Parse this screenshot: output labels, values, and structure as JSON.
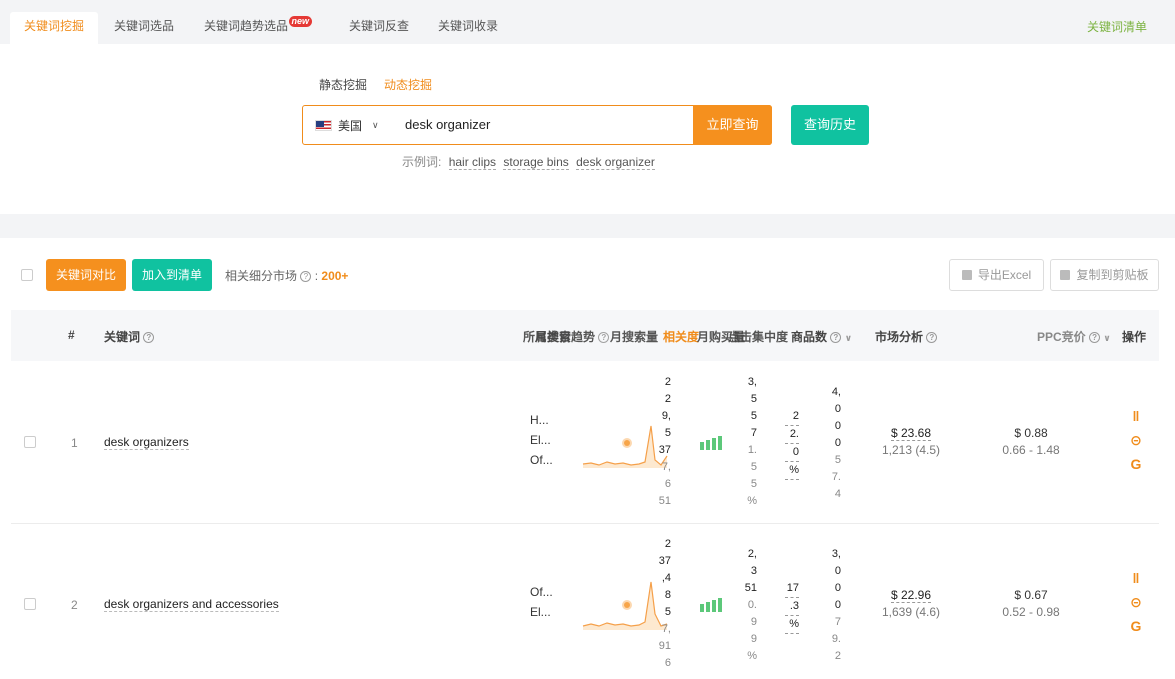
{
  "tabs": [
    {
      "label": "关键词挖掘",
      "active": true
    },
    {
      "label": "关键词选品",
      "active": false
    },
    {
      "label": "关键词趋势选品",
      "active": false,
      "badge": "new"
    },
    {
      "label": "关键词反查",
      "active": false
    },
    {
      "label": "关键词收录",
      "active": false
    }
  ],
  "top_right_link": "关键词清单",
  "search": {
    "modes": [
      {
        "label": "静态挖掘",
        "active": false
      },
      {
        "label": "动态挖掘",
        "active": true
      }
    ],
    "country": "美国",
    "query": "desk organizer",
    "submit_label": "立即查询",
    "history_label": "查询历史",
    "examples_label": "示例词:",
    "examples": [
      "hair clips",
      "storage bins",
      "desk organizer"
    ]
  },
  "toolbar": {
    "compare_label": "关键词对比",
    "add_label": "加入到清单",
    "market_label": "相关细分市场",
    "market_count": "200+",
    "export_label": "导出Excel",
    "copy_label": "复制到剪贴板"
  },
  "table": {
    "headers": {
      "index": "#",
      "keyword": "关键词",
      "categories": "所属类目",
      "trend_overlap": "月搜索趋势",
      "search_volume": "月搜索量",
      "relevance": "相关度",
      "purchase": "月购买量",
      "click_concentration": "点击集中度",
      "products": "商品数",
      "market": "市场分析",
      "ppc": "PPC竞价",
      "actions": "操作"
    },
    "rows": [
      {
        "index": "1",
        "keyword": "desk organizers",
        "categories": [
          "H...",
          "El...",
          "Of..."
        ],
        "volume_stack": [
          "2",
          "2",
          "9,",
          "5",
          "37",
          "7,",
          "6",
          "51"
        ],
        "purchase_stack": [
          "3,",
          "5",
          "5",
          "7",
          "1.",
          "5",
          "5",
          "%"
        ],
        "concentration_stack": [
          "2",
          "2.",
          "0",
          "%"
        ],
        "products_stack": [
          "4,",
          "0",
          "0",
          "0",
          "5",
          "7.",
          "4"
        ],
        "market_price": "$ 23.68",
        "market_sub": "1,213 (4.5)",
        "ppc_price": "$ 0.88",
        "ppc_range": "0.66 - 1.48",
        "spark_peak": 0.95,
        "bars": [
          3,
          4,
          5,
          6
        ]
      },
      {
        "index": "2",
        "keyword": "desk organizers and accessories",
        "categories": [
          "Of...",
          "El..."
        ],
        "volume_stack": [
          "2",
          "37",
          ",4",
          "8",
          "5",
          "7,",
          "91",
          "6"
        ],
        "purchase_stack": [
          "2,",
          "3",
          "51",
          "0.",
          "9",
          "9",
          "%"
        ],
        "concentration_stack": [
          "17",
          ".3",
          "%"
        ],
        "products_stack": [
          "3,",
          "0",
          "0",
          "0",
          "7",
          "9.",
          "2"
        ],
        "market_price": "$ 22.96",
        "market_sub": "1,639 (4.6)",
        "ppc_price": "$ 0.67",
        "ppc_range": "0.52 - 0.98",
        "spark_peak": 0.85,
        "bars": [
          3,
          4,
          5,
          6
        ]
      }
    ]
  },
  "colors": {
    "accent": "#f5901e",
    "teal": "#10c2a0",
    "green_link": "#7cb342"
  },
  "icons": [
    "chart-icon",
    "more-icon",
    "google-icon",
    "download-icon",
    "copy-icon",
    "help-icon",
    "chevron-down-icon"
  ]
}
